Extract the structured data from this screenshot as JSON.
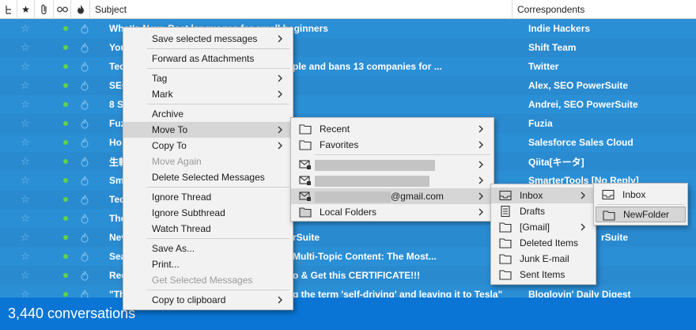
{
  "header": {
    "columns": [
      "Subject",
      "Correspondents"
    ]
  },
  "threads": [
    {
      "subject": "What's New: Best languages for small beginners",
      "correspondent": "Indie Hackers"
    },
    {
      "subject": "You",
      "correspondent": "Shift Team"
    },
    {
      "subject": "Tec",
      "subject_tail": "ple and bans 13 companies for ...",
      "correspondent": "Twitter"
    },
    {
      "subject": "SEO",
      "correspondent": "Alex, SEO PowerSuite"
    },
    {
      "subject": "8 S",
      "correspondent": "Andrei, SEO PowerSuite"
    },
    {
      "subject": "Fuz",
      "correspondent": "Fuzia"
    },
    {
      "subject": "Ho",
      "correspondent": "Salesforce Sales Cloud"
    },
    {
      "subject": "生転",
      "correspondent": "Qiita[キータ]"
    },
    {
      "subject": "Sm",
      "correspondent": "SmarterTools [No Reply]"
    },
    {
      "subject": "Tec",
      "correspondent": ""
    },
    {
      "subject": "The",
      "correspondent": ""
    },
    {
      "subject": "Nev",
      "subject_tail": "rSuite",
      "correspondent": "rSuite"
    },
    {
      "subject": "Sea",
      "subject_tail": "Multi-Topic Content: The Most...",
      "correspondent": ""
    },
    {
      "subject": "Rec",
      "subject_tail": "o & Get this CERTIFICATE!!!",
      "correspondent": ""
    },
    {
      "subject": "\"Th",
      "subject_tail": "g the term 'self-driving' and leaving it to Tesla\"",
      "correspondent": "Bloglovin' Daily Digest"
    }
  ],
  "status": {
    "count": "3,440 conversations"
  },
  "context_menu": {
    "save_selected": "Save selected messages",
    "forward_attach": "Forward as Attachments",
    "tag": "Tag",
    "mark": "Mark",
    "archive": "Archive",
    "move_to": "Move To",
    "copy_to": "Copy To",
    "move_again": "Move Again",
    "delete_selected": "Delete Selected Messages",
    "ignore_thread": "Ignore Thread",
    "ignore_subthread": "Ignore Subthread",
    "watch_thread": "Watch Thread",
    "save_as": "Save As...",
    "print": "Print...",
    "get_selected": "Get Selected Messages",
    "copy_clipboard": "Copy to clipboard"
  },
  "move_menu": {
    "recent": "Recent",
    "favorites": "Favorites",
    "gmail_account": "@gmail.com",
    "local_folders": "Local Folders"
  },
  "account_menu": {
    "inbox": "Inbox",
    "drafts": "Drafts",
    "gmail": "[Gmail]",
    "deleted": "Deleted Items",
    "junk": "Junk E-mail",
    "sent": "Sent Items"
  },
  "inbox_menu": {
    "inbox": "Inbox",
    "new_folder": "NewFolder"
  }
}
